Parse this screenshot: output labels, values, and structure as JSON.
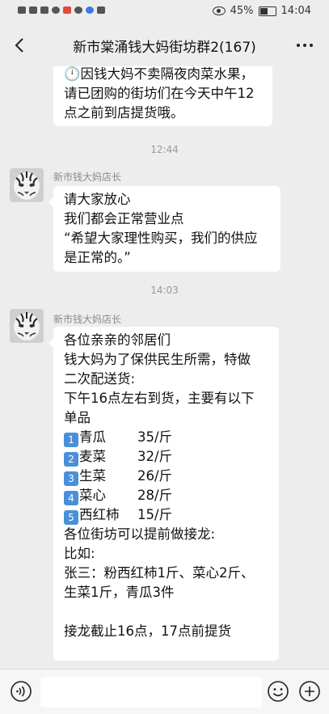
{
  "status_bar": {
    "battery": "45%",
    "time": "14:04",
    "battery_level": 0.45
  },
  "nav": {
    "title": "新市棠涌钱大妈街坊群2(167)"
  },
  "messages": {
    "partial": {
      "lines": [
        "🕛因钱大妈不卖隔夜肉菜水果，",
        "请已团购的街坊们在今天中午12",
        "点之前到店提货哦。"
      ]
    },
    "time1": "12:44",
    "msg1": {
      "sender": "新市钱大妈店长",
      "lines": [
        "请大家放心",
        "我们都会正常营业点",
        "“希望大家理性购买，我们的供应",
        "是正常的。”"
      ]
    },
    "time2": "14:03",
    "msg2": {
      "sender": "新市钱大妈店长",
      "lines_top": [
        "各位亲亲的邻居们",
        "钱大妈为了保供民生所需，特做",
        "二次配送货:",
        "下午16点左右到货，主要有以下",
        "单品"
      ],
      "items": [
        {
          "num": "1",
          "name": "青瓜",
          "price": "35/斤"
        },
        {
          "num": "2",
          "name": "麦菜",
          "price": "32/斤"
        },
        {
          "num": "3",
          "name": "生菜",
          "price": "26/斤"
        },
        {
          "num": "4",
          "name": "菜心",
          "price": "28/斤"
        },
        {
          "num": "5",
          "name": "西红柿",
          "price": "15/斤"
        }
      ],
      "lines_bottom": [
        "各位街坊可以提前做接龙:",
        "比如:",
        "张三：粉西红柿1斤、菜心2斤、",
        "生菜1斤，青瓜3件"
      ],
      "last_line": "接龙截止16点，17点前提货"
    }
  },
  "input_bar": {
    "value": ""
  },
  "icons": {
    "back": "back-arrow-icon",
    "more": "more-dots-icon",
    "voice": "voice-icon",
    "emoji": "emoji-icon",
    "plus": "plus-icon",
    "avatar": "tiger-avatar"
  },
  "colors": {
    "background": "#ededed",
    "bubble": "#ffffff",
    "number_badge": "#4a90d9"
  }
}
